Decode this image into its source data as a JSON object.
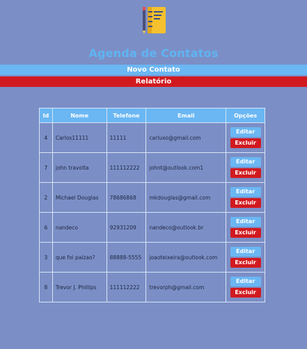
{
  "header": {
    "title": "Agenda de Contatos",
    "logo_icon": "notebook-pencil-icon"
  },
  "nav": {
    "new_contact_label": "Novo Contato",
    "report_label": "Relatório"
  },
  "colors": {
    "background": "#7b8fc6",
    "accent_blue": "#6ab7f3",
    "accent_red": "#d11a1f",
    "title": "#5fb4f2"
  },
  "table": {
    "columns": [
      "Id",
      "Nome",
      "Telefone",
      "Email",
      "Opções"
    ],
    "rows": [
      {
        "id": "4",
        "name": "Carlos11111",
        "phone": "11111",
        "email": "carluxo@gmail.com"
      },
      {
        "id": "7",
        "name": "john travolta",
        "phone": "111112222",
        "email": "johnt@outlook.com1"
      },
      {
        "id": "2",
        "name": "Michael Douglas",
        "phone": "78686868",
        "email": "mkdouglas@gmail.com"
      },
      {
        "id": "6",
        "name": "nandeco",
        "phone": "92931209",
        "email": "nandeco@outlook.br"
      },
      {
        "id": "3",
        "name": "que foi paizao?",
        "phone": "88888-5555",
        "email": "joaoteixeira@outlook.com"
      },
      {
        "id": "8",
        "name": "Trevor J. Phillips",
        "phone": "111112222",
        "email": "trevorph@gmail.com"
      }
    ],
    "edit_label": "Editar",
    "delete_label": "Excluir"
  }
}
